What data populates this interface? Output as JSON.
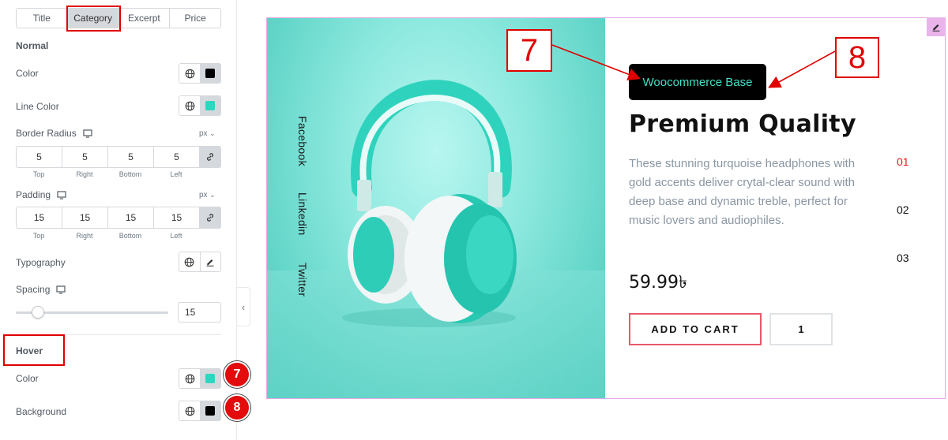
{
  "tabs": [
    "Title",
    "Category",
    "Excerpt",
    "Price"
  ],
  "active_tab": "Category",
  "normal": {
    "heading": "Normal",
    "color_label": "Color",
    "color_value": "#000000",
    "line_color_label": "Line Color",
    "line_color_value": "#2ad8c0",
    "border_radius_label": "Border Radius",
    "border_radius_unit": "px",
    "border_radius": [
      "5",
      "5",
      "5",
      "5"
    ],
    "padding_label": "Padding",
    "padding_unit": "px",
    "padding": [
      "15",
      "15",
      "15",
      "15"
    ],
    "side_labels": [
      "Top",
      "Right",
      "Bottom",
      "Left"
    ],
    "typography_label": "Typography",
    "spacing_label": "Spacing",
    "spacing_value": "15"
  },
  "hover": {
    "heading": "Hover",
    "color_label": "Color",
    "color_value": "#2ad8c0",
    "background_label": "Background",
    "background_value": "#000000",
    "badge_color": "7",
    "badge_background": "8"
  },
  "preview": {
    "social_links": [
      "Facebook",
      "Linkedin",
      "Twitter"
    ],
    "category": "Woocommerce Base",
    "title": "Premium Quality",
    "excerpt": "These stunning turquoise headphones with gold accents deliver crytal-clear sound with deep base and dynamic treble, perfect for music lovers and audiophiles.",
    "price": "59.99৳",
    "add_to_cart": "ADD TO CART",
    "quantity": "1",
    "nav_numbers": [
      "01",
      "02",
      "03"
    ],
    "accent_color": "#e8161e",
    "image_description_icon": "headphones-icon"
  },
  "callouts": [
    "7",
    "8"
  ]
}
